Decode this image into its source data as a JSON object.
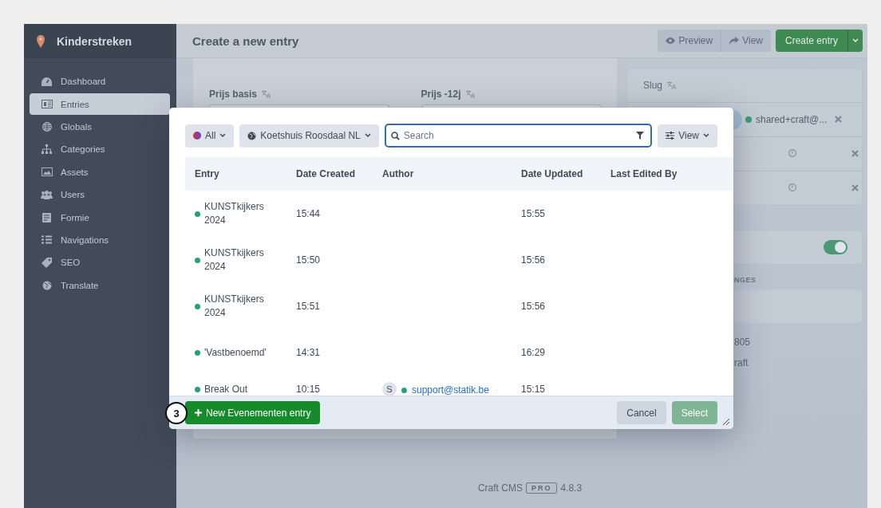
{
  "sidebar": {
    "site_name": "Kinderstreken",
    "items": [
      {
        "label": "Dashboard",
        "selected": false
      },
      {
        "label": "Entries",
        "selected": true
      },
      {
        "label": "Globals",
        "selected": false
      },
      {
        "label": "Categories",
        "selected": false
      },
      {
        "label": "Assets",
        "selected": false
      },
      {
        "label": "Users",
        "selected": false
      },
      {
        "label": "Formie",
        "selected": false
      },
      {
        "label": "Navigations",
        "selected": false
      },
      {
        "label": "SEO",
        "selected": false
      },
      {
        "label": "Translate",
        "selected": false
      }
    ]
  },
  "header": {
    "title": "Create a new entry",
    "buttons": [
      {
        "label": "Preview"
      },
      {
        "label": "View"
      }
    ],
    "primary_button": "Create entry"
  },
  "fields": [
    {
      "label": "Prijs basis"
    },
    {
      "label": "Prijs -12j"
    }
  ],
  "side_panel": {
    "slug_label": "Slug",
    "author": "shared+craft@...",
    "toggle_on": true,
    "section_label": "NGES",
    "meta": [
      "805",
      "raft"
    ]
  },
  "modal": {
    "source_filter": "All",
    "site_filter": "Koetshuis Roosdaal NL",
    "search_placeholder": "Search",
    "view_button": "View",
    "columns": [
      "Entry",
      "Date Created",
      "Author",
      "Date Updated",
      "Last Edited By"
    ],
    "rows": [
      {
        "entry": "KUNSTkijkers 2024",
        "date_created": "15:44",
        "date_updated": "15:55"
      },
      {
        "entry": "KUNSTkijkers 2024",
        "date_created": "15:50",
        "date_updated": "15:56"
      },
      {
        "entry": "KUNSTkijkers 2024",
        "date_created": "15:51",
        "date_updated": "15:56"
      },
      {
        "entry": "'Vastbenoemd'",
        "date_created": "14:31",
        "date_updated": "16:29"
      },
      {
        "entry": "Break Out",
        "date_created": "10:15",
        "author": "support@statik.be",
        "author_initial": "S",
        "date_updated": "15:15"
      }
    ],
    "step_marker": "3",
    "new_button": "New Evenementen entry",
    "cancel_button": "Cancel",
    "select_button": "Select",
    "select_disabled": true
  },
  "footer": {
    "product": "Craft CMS",
    "edition": "PRO",
    "version": "4.8.3"
  }
}
